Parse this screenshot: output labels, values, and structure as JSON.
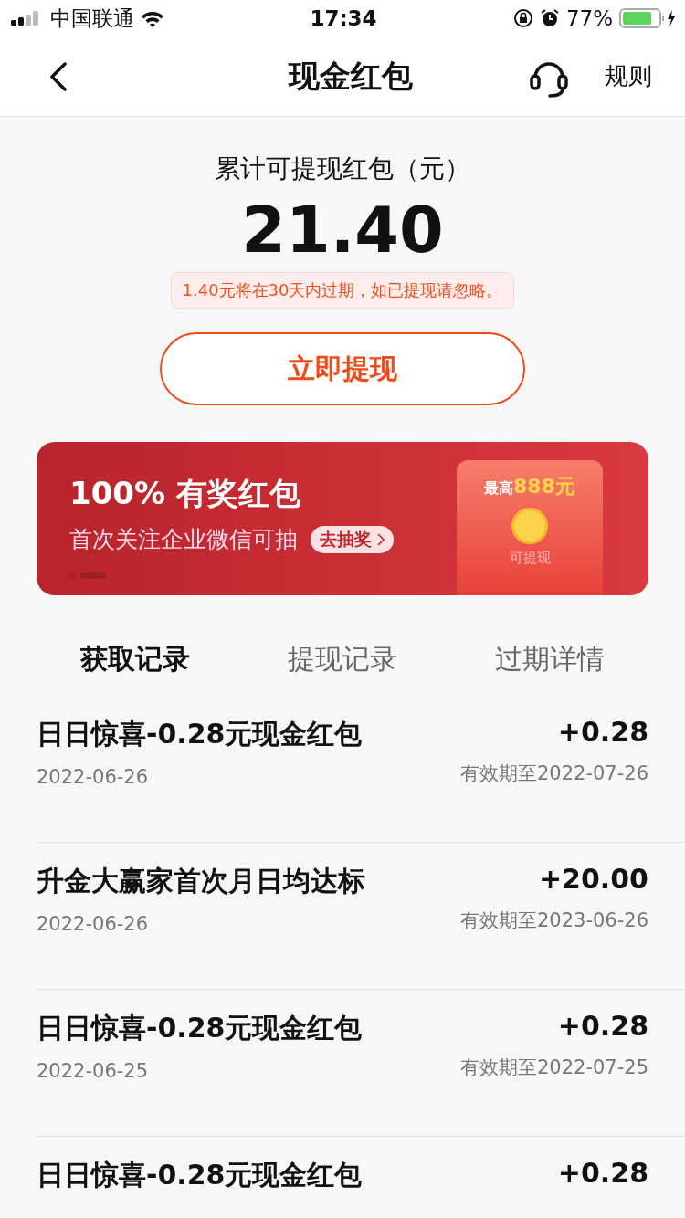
{
  "status_bar": {
    "carrier": "中国联通",
    "time": "17:34",
    "battery_percent": "77%"
  },
  "nav": {
    "title": "现金红包",
    "rules": "规则"
  },
  "summary": {
    "label": "累计可提现红包（元）",
    "amount": "21.40",
    "notice": "1.40元将在30天内过期，如已提现请忽略。",
    "button": "立即提现"
  },
  "banner": {
    "headline": "100% 有奖红包",
    "subtitle": "首次关注企业微信可抽",
    "action": "去抽奖",
    "art_top": "最高",
    "art_amount": "888元",
    "art_bottom": "可提现",
    "dots": [
      {
        "selected": false
      },
      {
        "selected": true
      }
    ]
  },
  "tabs": [
    {
      "label": "获取记录",
      "selected": true
    },
    {
      "label": "提现记录",
      "selected": false
    },
    {
      "label": "过期详情",
      "selected": false
    }
  ],
  "records": [
    {
      "title": "日日惊喜-0.28元现金红包",
      "date": "2022-06-26",
      "amount": "+0.28",
      "expiry": "有效期至2022-07-26"
    },
    {
      "title": "升金大赢家首次月日均达标",
      "date": "2022-06-26",
      "amount": "+20.00",
      "expiry": "有效期至2023-06-26"
    },
    {
      "title": "日日惊喜-0.28元现金红包",
      "date": "2022-06-25",
      "amount": "+0.28",
      "expiry": "有效期至2022-07-25"
    },
    {
      "title": "日日惊喜-0.28元现金红包",
      "amount": "+0.28"
    }
  ]
}
